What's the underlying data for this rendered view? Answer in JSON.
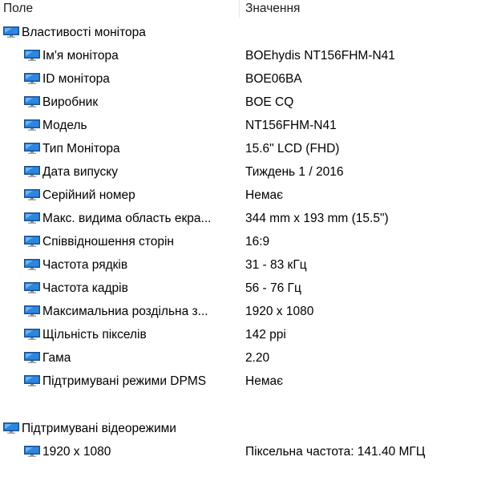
{
  "columns": {
    "field": "Поле",
    "value": "Значення"
  },
  "section_monitor": {
    "title": "Властивості монітора",
    "icon": "monitor-icon",
    "rows": [
      {
        "label": "Ім'я монітора",
        "value": "BOEhydis NT156FHM-N41"
      },
      {
        "label": "ID монітора",
        "value": "BOE06BA"
      },
      {
        "label": "Виробник",
        "value": "BOE CQ"
      },
      {
        "label": "Модель",
        "value": "NT156FHM-N41"
      },
      {
        "label": "Тип Монітора",
        "value": "15.6\" LCD (FHD)"
      },
      {
        "label": "Дата випуску",
        "value": "Тиждень 1 / 2016"
      },
      {
        "label": "Серійний номер",
        "value": "Немає"
      },
      {
        "label": "Макс. видима область екра...",
        "value": "344 mm x 193 mm (15.5\")"
      },
      {
        "label": "Співвідношення сторін",
        "value": "16:9"
      },
      {
        "label": "Частота рядків",
        "value": "31 - 83 кГц"
      },
      {
        "label": "Частота кадрів",
        "value": "56 - 76 Гц"
      },
      {
        "label": "Максимальниа роздільна з...",
        "value": "1920 x 1080"
      },
      {
        "label": "Щільність пікселів",
        "value": "142 ppi"
      },
      {
        "label": "Гама",
        "value": "2.20"
      },
      {
        "label": "Підтримувані режими DPMS",
        "value": "Немає"
      }
    ]
  },
  "section_modes": {
    "title": "Підтримувані відеорежими",
    "icon": "monitor-icon",
    "rows": [
      {
        "label": "1920 x 1080",
        "value": "Піксельна частота: 141.40 МГЦ"
      }
    ]
  },
  "colors": {
    "icon_blue": "#1f6fc5",
    "icon_light": "#6fb4f0",
    "icon_stand": "#8a8a8a"
  }
}
